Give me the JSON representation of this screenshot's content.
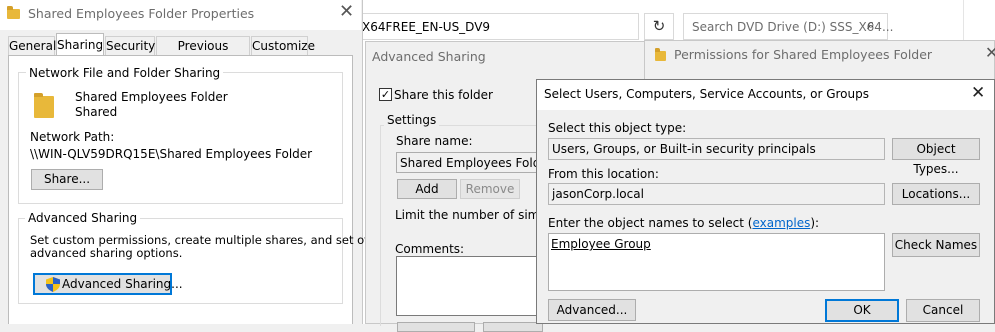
{
  "props": {
    "title": "Shared Employees Folder Properties",
    "tabs": [
      "General",
      "Sharing",
      "Security",
      "Previous Versions",
      "Customize"
    ],
    "file_sharing_group": "Network File and Folder Sharing",
    "folder_name": "Shared Employees Folder",
    "folder_status": "Shared",
    "network_path_label": "Network Path:",
    "network_path": "\\\\WIN-QLV59DRQ15E\\Shared Employees Folder",
    "share_button": "Share...",
    "advanced_group": "Advanced Sharing",
    "advanced_desc_1": "Set custom permissions, create multiple shares, and set other",
    "advanced_desc_2": "advanced sharing options.",
    "advanced_button": "Advanced Sharing..."
  },
  "explorer": {
    "path": "X64FREE_EN-US_DV9",
    "search_placeholder": "Search DVD Drive (D:) SSS_X64..."
  },
  "advanced": {
    "title": "Advanced Sharing",
    "share_checkbox": "Share this folder",
    "settings_label": "Settings",
    "share_name_label": "Share name:",
    "share_name_value": "Shared Employees Folder",
    "add_button": "Add",
    "remove_button": "Remove",
    "limit_label": "Limit the number of simultane",
    "comments_label": "Comments:"
  },
  "permissions": {
    "title": "Permissions for Shared Employees Folder"
  },
  "select": {
    "title": "Select Users, Computers, Service Accounts, or Groups",
    "object_type_label": "Select this object type:",
    "object_type_value": "Users, Groups, or Built-in security principals",
    "object_types_button": "Object Types...",
    "location_label": "From this location:",
    "location_value": "jasonCorp.local",
    "locations_button": "Locations...",
    "enter_label_pre": "Enter the object names to select (",
    "enter_label_link": "examples",
    "enter_label_post": "):",
    "names_value": "Employee Group",
    "check_names_button": "Check Names",
    "advanced_button": "Advanced...",
    "ok_button": "OK",
    "cancel_button": "Cancel"
  },
  "colors": {
    "accent": "#0078d7",
    "link": "#0066cc",
    "folder": "#e8b83a"
  }
}
